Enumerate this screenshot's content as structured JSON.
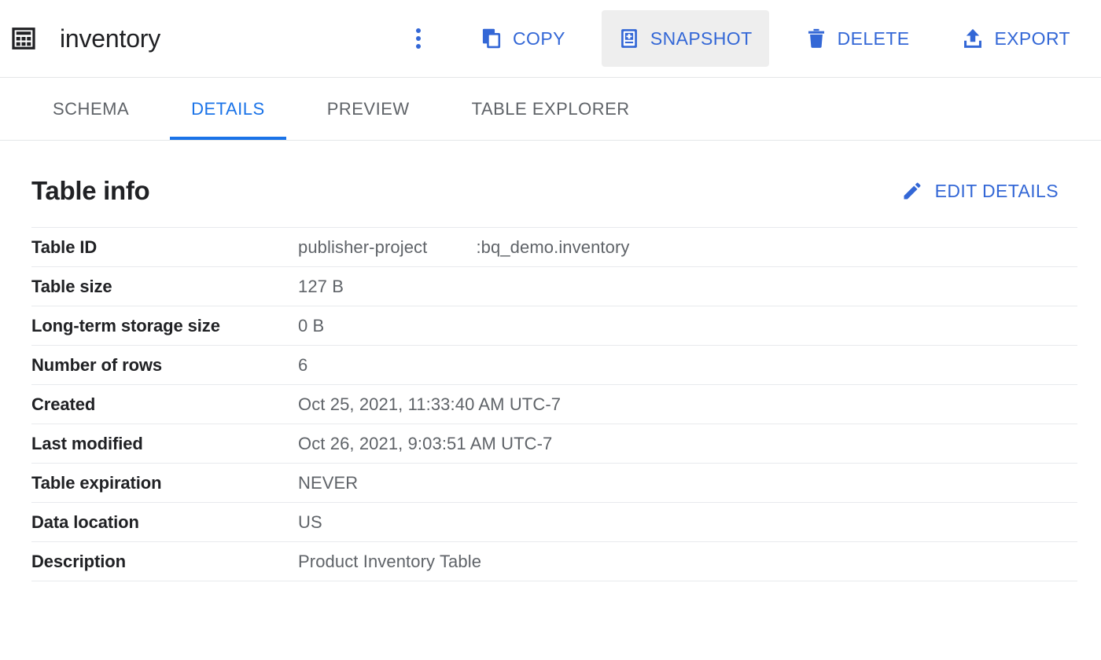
{
  "header": {
    "table_icon": "table-grid-icon",
    "title": "inventory",
    "overflow_menu": "more-options-icon",
    "buttons": [
      {
        "id": "copy",
        "label": "COPY",
        "icon": "copy-icon",
        "active": false
      },
      {
        "id": "snapshot",
        "label": "SNAPSHOT",
        "icon": "snapshot-icon",
        "active": true
      },
      {
        "id": "delete",
        "label": "DELETE",
        "icon": "trash-icon",
        "active": false
      },
      {
        "id": "export",
        "label": "EXPORT",
        "icon": "upload-icon",
        "active": false
      }
    ]
  },
  "tabs": [
    {
      "id": "schema",
      "label": "SCHEMA",
      "selected": false
    },
    {
      "id": "details",
      "label": "DETAILS",
      "selected": true
    },
    {
      "id": "preview",
      "label": "PREVIEW",
      "selected": false
    },
    {
      "id": "table-explorer",
      "label": "TABLE EXPLORER",
      "selected": false
    }
  ],
  "section": {
    "title": "Table info",
    "edit_label": "EDIT DETAILS",
    "edit_icon": "pencil-icon"
  },
  "table_info": {
    "rows": [
      {
        "label": "Table ID",
        "value": "publisher-project          :bq_demo.inventory"
      },
      {
        "label": "Table size",
        "value": "127 B"
      },
      {
        "label": "Long-term storage size",
        "value": "0 B"
      },
      {
        "label": "Number of rows",
        "value": "6"
      },
      {
        "label": "Created",
        "value": "Oct 25, 2021, 11:33:40 AM UTC-7"
      },
      {
        "label": "Last modified",
        "value": "Oct 26, 2021, 9:03:51 AM UTC-7"
      },
      {
        "label": "Table expiration",
        "value": "NEVER"
      },
      {
        "label": "Data location",
        "value": "US"
      },
      {
        "label": "Description",
        "value": "Product Inventory Table"
      }
    ]
  },
  "colors": {
    "accent_blue": "#3367d6",
    "tab_blue": "#1a73e8",
    "text_primary": "#202124",
    "text_secondary": "#5f6368",
    "divider": "#e8eaed",
    "active_button_bg": "#eeeeee"
  }
}
